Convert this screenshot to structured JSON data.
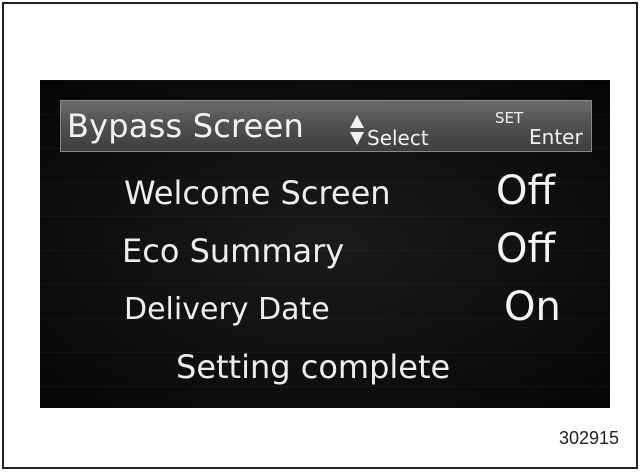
{
  "header": {
    "title": "Bypass Screen",
    "select_label": "Select",
    "set_label": "SET",
    "enter_label": "Enter"
  },
  "settings": [
    {
      "label": "Welcome Screen",
      "value": "Off"
    },
    {
      "label": "Eco Summary",
      "value": "Off"
    },
    {
      "label": "Delivery Date",
      "value": "On"
    }
  ],
  "status": "Setting complete",
  "figure_id": "302915",
  "colors": {
    "screen_background": "#0c0c0c",
    "header_bar": "#525252",
    "text": "#eeeeee"
  },
  "icons": {
    "select": "updown-arrows-icon"
  }
}
